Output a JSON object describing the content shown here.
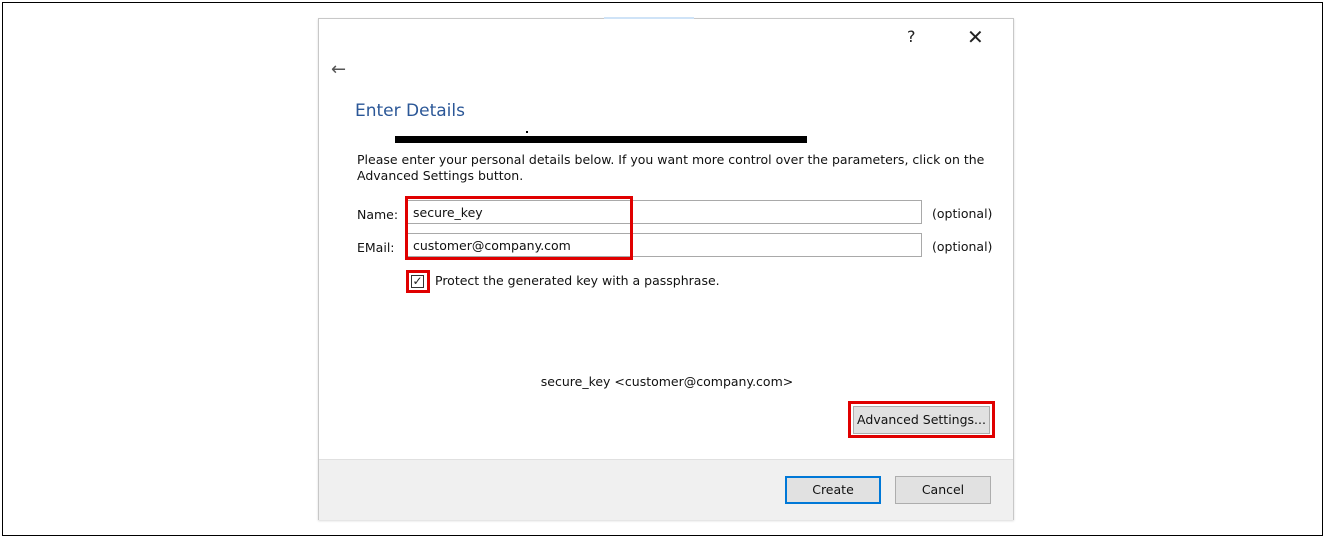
{
  "dialog": {
    "help_label": "?",
    "close_label": "✕",
    "back_label": "←",
    "title": "Enter Details",
    "description": "Please enter your personal details below. If you want more control over the parameters, click on the Advanced Settings button.",
    "name": {
      "label": "Name:",
      "value": "secure_key",
      "optional": "(optional)"
    },
    "email": {
      "label": "EMail:",
      "value": "customer@company.com",
      "optional": "(optional)"
    },
    "passphrase": {
      "checked": true,
      "check_glyph": "✓",
      "label": "Protect the generated key with a passphrase."
    },
    "preview": "secure_key <customer@company.com>",
    "advanced_button": "Advanced Settings...",
    "create_button": "Create",
    "cancel_button": "Cancel"
  },
  "colors": {
    "title": "#2b5797",
    "highlight": "#e00000",
    "default_button_border": "#0078d7"
  },
  "icons": {
    "back": "arrow-left-icon",
    "close": "close-icon",
    "help": "help-icon",
    "check": "checkmark-icon"
  }
}
